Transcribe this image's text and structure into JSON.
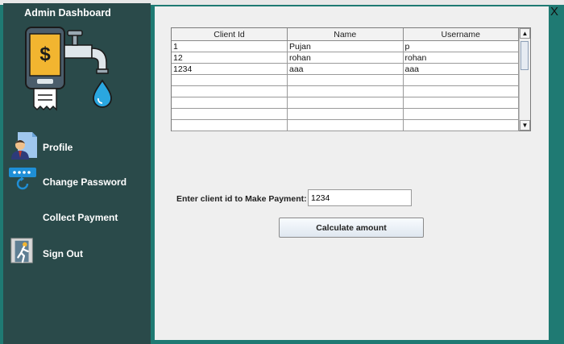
{
  "sidebar": {
    "title": "Admin Dashboard",
    "items": [
      {
        "label": "Profile",
        "icon": "profile-icon"
      },
      {
        "label": "Change Password",
        "icon": "password-icon"
      },
      {
        "label": "Collect Payment",
        "icon": ""
      },
      {
        "label": "Sign Out",
        "icon": "sign-out-icon"
      }
    ]
  },
  "window": {
    "close_label": "X"
  },
  "table": {
    "columns": [
      "Client Id",
      "Name",
      "Username"
    ],
    "rows": [
      [
        "1",
        "Pujan",
        "p"
      ],
      [
        "12",
        "rohan",
        "rohan"
      ],
      [
        "1234",
        "aaa",
        "aaa"
      ],
      [
        "",
        "",
        ""
      ],
      [
        "",
        "",
        ""
      ],
      [
        "",
        "",
        ""
      ],
      [
        "",
        "",
        ""
      ],
      [
        "",
        "",
        ""
      ]
    ]
  },
  "payment": {
    "label": "Enter client id to Make Payment:",
    "client_id_value": "1234",
    "button_label": "Calculate amount"
  },
  "colors": {
    "accent": "#1f7a73",
    "sidebar_bg": "#2a4a4a",
    "panel_bg": "#efefef"
  }
}
